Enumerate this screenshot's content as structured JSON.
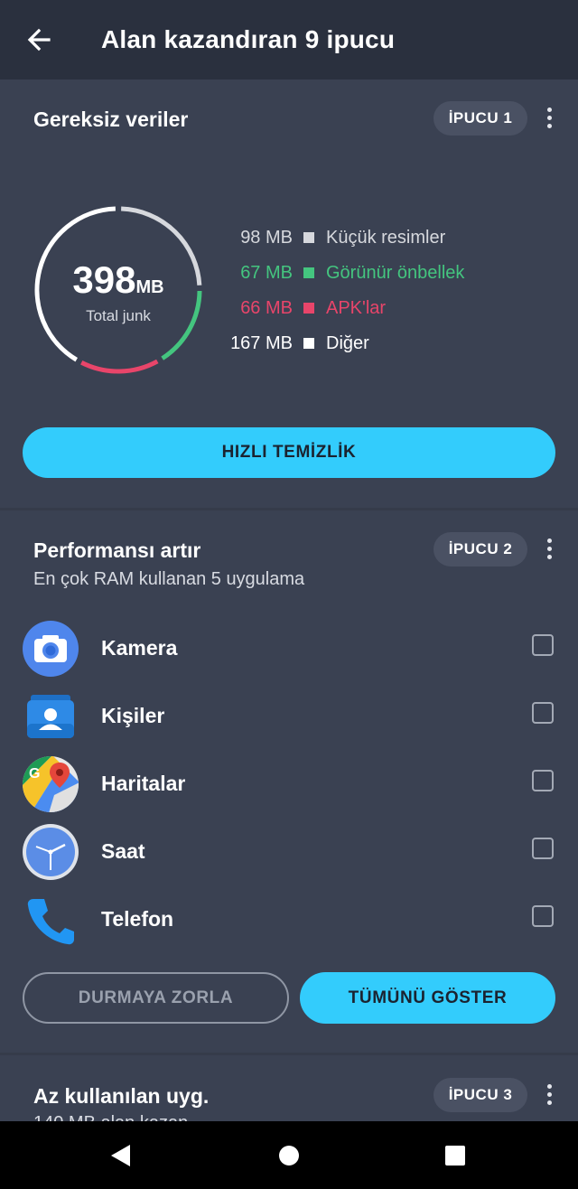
{
  "appbar": {
    "title": "Alan kazandıran 9 ipucu",
    "back_icon": "arrow-left-icon"
  },
  "junk_card": {
    "title": "Gereksiz veriler",
    "badge": "İPUCU 1",
    "total_value": "398",
    "total_unit": "MB",
    "total_label": "Total junk",
    "legend": [
      {
        "size": "98 MB",
        "label": "Küçük resimler",
        "color": "#d6d8dd",
        "text_color": "#d6d8dd"
      },
      {
        "size": "67 MB",
        "label": "Görünür önbellek",
        "color": "#44c57f",
        "text_color": "#44c57f"
      },
      {
        "size": "66 MB",
        "label": "APK'lar",
        "color": "#e8456a",
        "text_color": "#e8456a"
      },
      {
        "size": "167 MB",
        "label": "Diğer",
        "color": "#ffffff",
        "text_color": "#ffffff"
      }
    ],
    "chart_data": {
      "type": "pie",
      "categories": [
        "Küçük resimler",
        "Görünür önbellek",
        "APK'lar",
        "Diğer"
      ],
      "values": [
        98,
        67,
        66,
        167
      ],
      "unit": "MB"
    },
    "clean_button": "HIZLI TEMİZLİK"
  },
  "performance_card": {
    "title": "Performansı artır",
    "subtitle": "En çok RAM kullanan 5 uygulama",
    "badge": "İPUCU 2",
    "apps": [
      {
        "name": "Kamera",
        "icon": "camera-app-icon"
      },
      {
        "name": "Kişiler",
        "icon": "contacts-app-icon"
      },
      {
        "name": "Haritalar",
        "icon": "maps-app-icon"
      },
      {
        "name": "Saat",
        "icon": "clock-app-icon"
      },
      {
        "name": "Telefon",
        "icon": "phone-app-icon"
      }
    ],
    "force_stop_button": "DURMAYA ZORLA",
    "show_all_button": "TÜMÜNÜ GÖSTER"
  },
  "unused_card": {
    "title": "Az kullanılan uyg.",
    "subtitle": "140 MB alan kazan",
    "badge": "İPUCU 3"
  },
  "colors": {
    "accent": "#33ccfc",
    "background": "#3a4152",
    "appbar": "#2a303e"
  },
  "navbar": {
    "back_icon": "nav-back-icon",
    "home_icon": "nav-home-icon",
    "recents_icon": "nav-recents-icon"
  }
}
